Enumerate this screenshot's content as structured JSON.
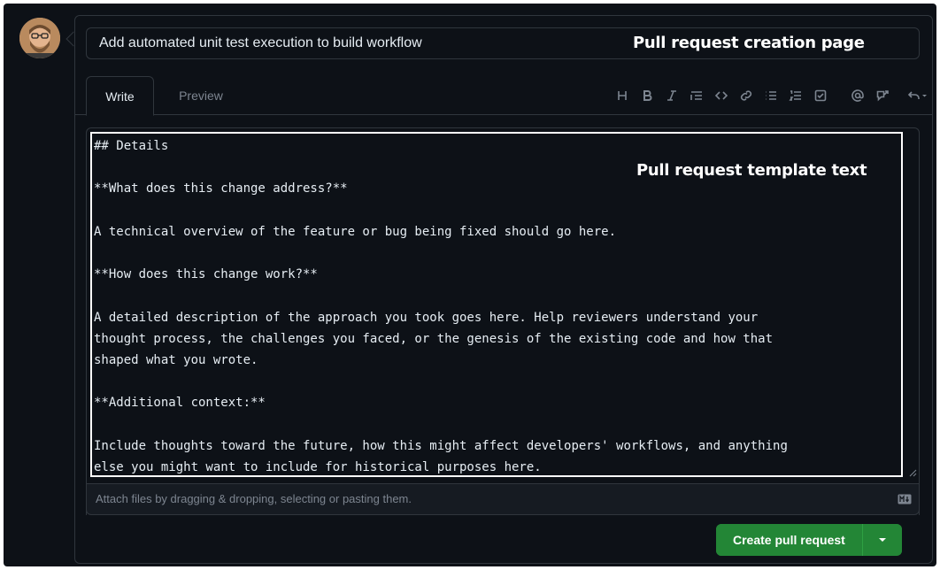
{
  "pr_title_value": "Add automated unit test execution to build workflow",
  "annotations": {
    "creation_page": "Pull request creation page",
    "template_text": "Pull request template text"
  },
  "tabs": {
    "write": "Write",
    "preview": "Preview"
  },
  "toolbar_icons": [
    "heading-icon",
    "bold-icon",
    "italic-icon",
    "quote-icon",
    "code-icon",
    "link-icon",
    "unordered-list-icon",
    "ordered-list-icon",
    "task-list-icon",
    "mention-icon",
    "cross-reference-icon",
    "saved-replies-icon"
  ],
  "editor_lines": [
    "## Details",
    "",
    "**What does this change address?**",
    "",
    "A technical overview of the feature or bug being fixed should go here.",
    "",
    "**How does this change work?**",
    "",
    "A detailed description of the approach you took goes here. Help reviewers understand your",
    "thought process, the challenges you faced, or the genesis of the existing code and how that",
    "shaped what you wrote.",
    "",
    "**Additional context:**",
    "",
    "Include thoughts toward the future, how this might affect developers' workflows, and anything",
    "else you might want to include for historical purposes here."
  ],
  "attach_hint": "Attach files by dragging & dropping, selecting or pasting them.",
  "create_button": "Create pull request",
  "colors": {
    "background": "#0d1117",
    "border": "#30363d",
    "primary_button": "#238636",
    "text": "#e6edf3",
    "muted": "#7d8590"
  }
}
